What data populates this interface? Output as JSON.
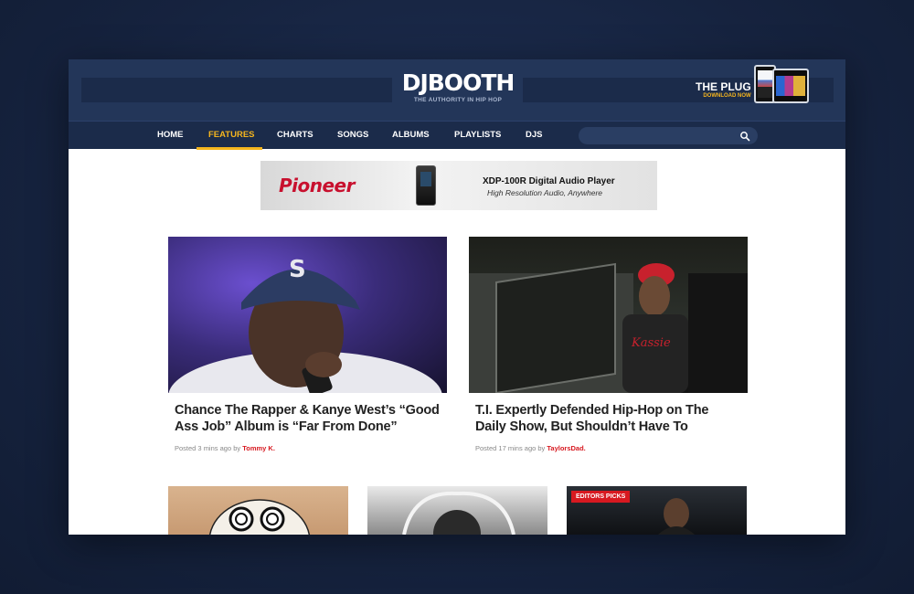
{
  "header": {
    "logo": "DJBOOTH",
    "tagline": "THE AUTHORITY IN HIP HOP",
    "promo_title": "THE PLUG",
    "promo_sub": "DOWNLOAD NOW"
  },
  "nav": {
    "items": [
      {
        "label": "HOME"
      },
      {
        "label": "FEATURES"
      },
      {
        "label": "CHARTS"
      },
      {
        "label": "SONGS"
      },
      {
        "label": "ALBUMS"
      },
      {
        "label": "PLAYLISTS"
      },
      {
        "label": "DJS"
      }
    ],
    "active": "FEATURES",
    "search_placeholder": ""
  },
  "ad": {
    "brand": "Pioneer",
    "product": "XDP-100R Digital Audio Player",
    "subtitle": "High Resolution Audio, Anywhere"
  },
  "articles": [
    {
      "title": "Chance The Rapper & Kanye West’s “Good Ass Job” Album is “Far From Done”",
      "meta_prefix": "Posted 3 mins ago by",
      "author": "Tommy K."
    },
    {
      "title": "T.I. Expertly Defended Hip-Hop on The Daily Show, But Shouldn’t Have To",
      "meta_prefix": "Posted 17 mins ago by",
      "author": "TaylorsDad."
    }
  ],
  "bottom_cards": {
    "badge": "EDITORS PICKS"
  },
  "colors": {
    "accent": "#f5b51e",
    "header_bg": "#233659",
    "nav_bg": "#1b2b4a",
    "author": "#d71920"
  }
}
